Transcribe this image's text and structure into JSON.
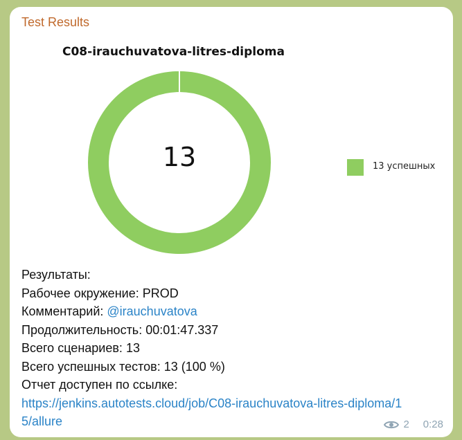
{
  "message": {
    "sender": "Test Results",
    "chart_data": {
      "type": "pie",
      "title": "C08-irauchuvatova-litres-diploma",
      "center_label": "13",
      "slices": [
        {
          "name": "13 успешных",
          "value": 13,
          "color": "#8fcd60"
        }
      ],
      "legend": {
        "position": "right"
      }
    },
    "results": {
      "heading": "Результаты:",
      "env_label": "Рабочее окружение:",
      "env_value": "PROD",
      "comment_label": "Комментарий:",
      "comment_value": "@irauchuvatova",
      "duration_label": "Продолжительность:",
      "duration_value": "00:01:47.337",
      "scenarios_label": "Всего сценариев:",
      "scenarios_value": "13",
      "passed_label": "Всего успешных тестов:",
      "passed_value": "13 (100 %)",
      "report_label": "Отчет доступен по ссылке:",
      "report_url": "https://jenkins.autotests.cloud/job/C08-irauchuvatova-litres-diploma/15/allure"
    },
    "views": "2",
    "time": "0:28"
  }
}
